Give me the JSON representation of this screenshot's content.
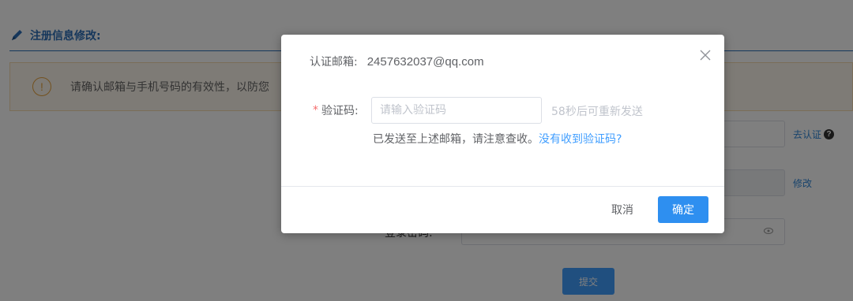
{
  "section": {
    "title": "注册信息修改:"
  },
  "notice": {
    "text": "请确认邮箱与手机号码的有效性，以防您"
  },
  "background_form": {
    "verify_link": "去认证",
    "modify_link": "修改",
    "password_label": "登录密码:",
    "submit_label": "提交"
  },
  "dialog": {
    "email_label": "认证邮箱:",
    "email_value": "2457632037@qq.com",
    "code_label": "验证码:",
    "code_required_mark": "*",
    "code_placeholder": "请输入验证码",
    "code_value": "",
    "countdown_text": "58秒后可重新发送",
    "hint_text": "已发送至上述邮箱，请注意查收。",
    "hint_link": "没有收到验证码?",
    "cancel_label": "取消",
    "confirm_label": "确定"
  },
  "colors": {
    "accent": "#2e8ff0",
    "link": "#409eff",
    "required": "#f56c6c",
    "warning": "#e6a23c"
  },
  "icons": {
    "header": "pencil-icon",
    "notice": "warning-circle-icon",
    "help": "question-circle-icon",
    "password": "eye-icon",
    "close": "close-icon"
  }
}
